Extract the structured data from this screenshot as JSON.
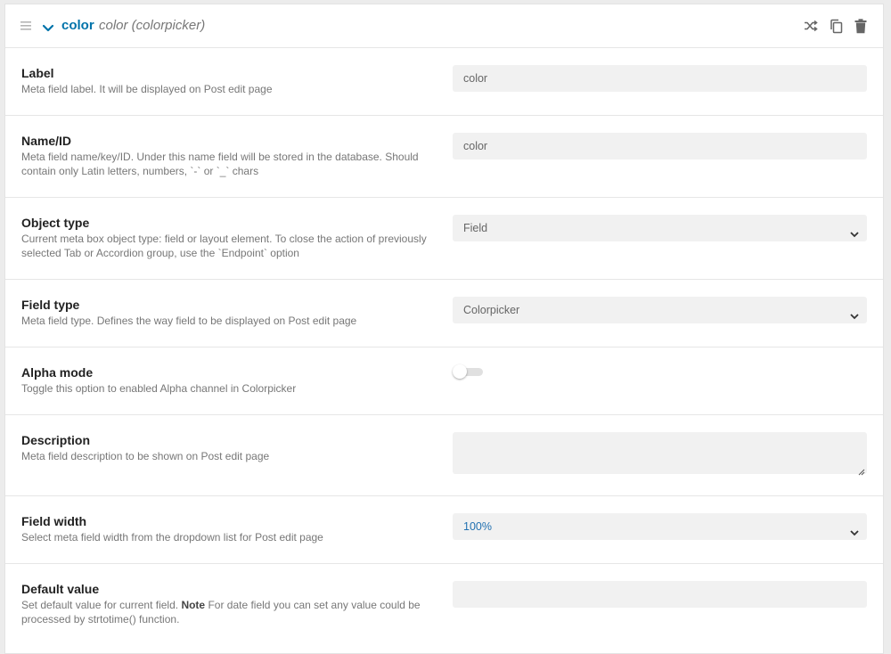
{
  "header": {
    "name": "color",
    "subtitle": "color (colorpicker)",
    "icons": [
      "drag-handle-icon",
      "chevron-down-icon",
      "shuffle-icon",
      "copy-icon",
      "trash-icon"
    ]
  },
  "fields": {
    "label": {
      "title": "Label",
      "description": "Meta field label. It will be displayed on Post edit page",
      "value": "color"
    },
    "name": {
      "title": "Name/ID",
      "description_line1": "Meta field name/key/ID. Under this name field will be stored in the database. Should",
      "description_line2": "contain only Latin letters, numbers, `-` or `_` chars",
      "value": "color"
    },
    "object_type": {
      "title": "Object type",
      "description_line1": "Current meta box object type: field or layout element. To close the action of previously",
      "description_line2": "selected Tab or Accordion group, use the `Endpoint` option",
      "value": "Field"
    },
    "field_type": {
      "title": "Field type",
      "description": "Meta field type. Defines the way field to be displayed on Post edit page",
      "value": "Colorpicker"
    },
    "alpha_mode": {
      "title": "Alpha mode",
      "description": "Toggle this option to enabled Alpha channel in Colorpicker",
      "enabled": false
    },
    "description": {
      "title": "Description",
      "description": "Meta field description to be shown on Post edit page",
      "value": ""
    },
    "field_width": {
      "title": "Field width",
      "description": "Select meta field width from the dropdown list for Post edit page",
      "value": "100%"
    },
    "default_value": {
      "title": "Default value",
      "description_pre": "Set default value for current field. ",
      "description_bold": "Note",
      "description_post": " For date field you can set any value could be",
      "description_line2": "processed by strtotime() function.",
      "value": ""
    }
  },
  "colors": {
    "accent": "#0073aa",
    "input_bg": "#f1f1f1",
    "border": "#e6e6e6"
  }
}
